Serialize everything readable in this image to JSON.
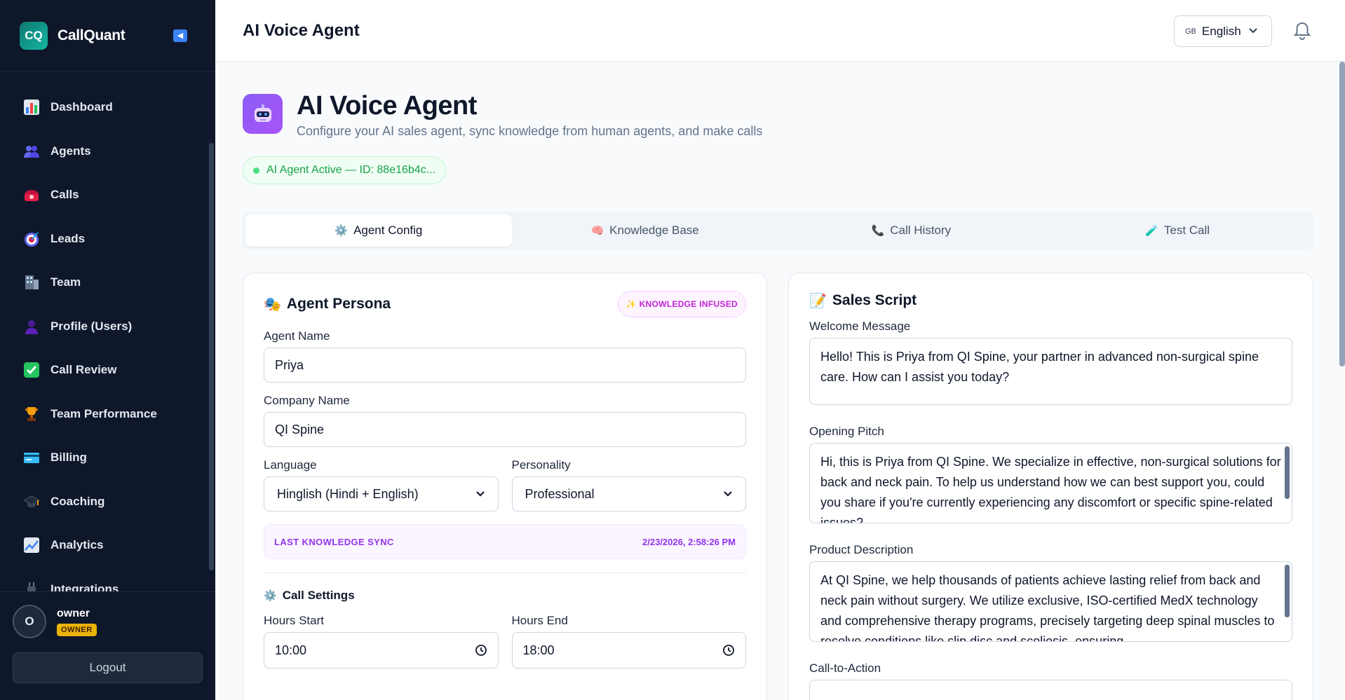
{
  "brand": {
    "logo_text": "CQ",
    "name": "CallQuant"
  },
  "nav": {
    "items": [
      {
        "label": "Dashboard",
        "icon": "bar-chart-icon"
      },
      {
        "label": "Agents",
        "icon": "people-icon"
      },
      {
        "label": "Calls",
        "icon": "telephone-icon"
      },
      {
        "label": "Leads",
        "icon": "target-icon"
      },
      {
        "label": "Team",
        "icon": "building-icon"
      },
      {
        "label": "Profile (Users)",
        "icon": "user-icon"
      },
      {
        "label": "Call Review",
        "icon": "check-icon"
      },
      {
        "label": "Team Performance",
        "icon": "trophy-icon"
      },
      {
        "label": "Billing",
        "icon": "credit-card-icon"
      },
      {
        "label": "Coaching",
        "icon": "graduation-cap-icon"
      },
      {
        "label": "Analytics",
        "icon": "line-chart-icon"
      },
      {
        "label": "Integrations",
        "icon": "plug-icon"
      }
    ]
  },
  "user": {
    "initial": "O",
    "name": "owner",
    "role": "OWNER",
    "logout_label": "Logout"
  },
  "header": {
    "title": "AI Voice Agent",
    "lang_flag": "GB",
    "lang_label": "English"
  },
  "page": {
    "title": "AI Voice Agent",
    "subtitle": "Configure your AI sales agent, sync knowledge from human agents, and make calls",
    "status": "AI Agent Active — ID: 88e16b4c..."
  },
  "tabs": [
    {
      "label": "Agent Config",
      "icon": "⚙️"
    },
    {
      "label": "Knowledge Base",
      "icon": "🧠"
    },
    {
      "label": "Call History",
      "icon": "📞"
    },
    {
      "label": "Test Call",
      "icon": "🧪"
    }
  ],
  "persona": {
    "title": "Agent Persona",
    "badge": "✨ KNOWLEDGE INFUSED",
    "agent_name_label": "Agent Name",
    "agent_name": "Priya",
    "company_label": "Company Name",
    "company": "QI Spine",
    "language_label": "Language",
    "language": "Hinglish (Hindi + English)",
    "personality_label": "Personality",
    "personality": "Professional",
    "sync_label": "LAST KNOWLEDGE SYNC",
    "sync_time": "2/23/2026, 2:58:26 PM",
    "call_settings_title": "Call Settings",
    "hours_start_label": "Hours Start",
    "hours_start": "10:00",
    "hours_end_label": "Hours End",
    "hours_end": "18:00"
  },
  "script": {
    "title": "Sales Script",
    "welcome_label": "Welcome Message",
    "welcome": "Hello! This is Priya from QI Spine, your partner in advanced non-surgical spine care. How can I assist you today?",
    "pitch_label": "Opening Pitch",
    "pitch": "Hi, this is Priya from QI Spine. We specialize in effective, non-surgical solutions for back and neck pain. To help us understand how we can best support you, could you share if you're currently experiencing any discomfort or specific spine-related issues?",
    "product_label": "Product Description",
    "product": "At QI Spine, we help thousands of patients achieve lasting relief from back and neck pain without surgery. We utilize exclusive, ISO-certified MedX technology and comprehensive therapy programs, precisely targeting deep spinal muscles to resolve conditions like slip disc and scoliosis, ensuring",
    "cta_label": "Call-to-Action"
  },
  "colors": {
    "sidebar_bg": "#0f172a",
    "accent": "#a855f7",
    "active_green": "#16a34a"
  }
}
